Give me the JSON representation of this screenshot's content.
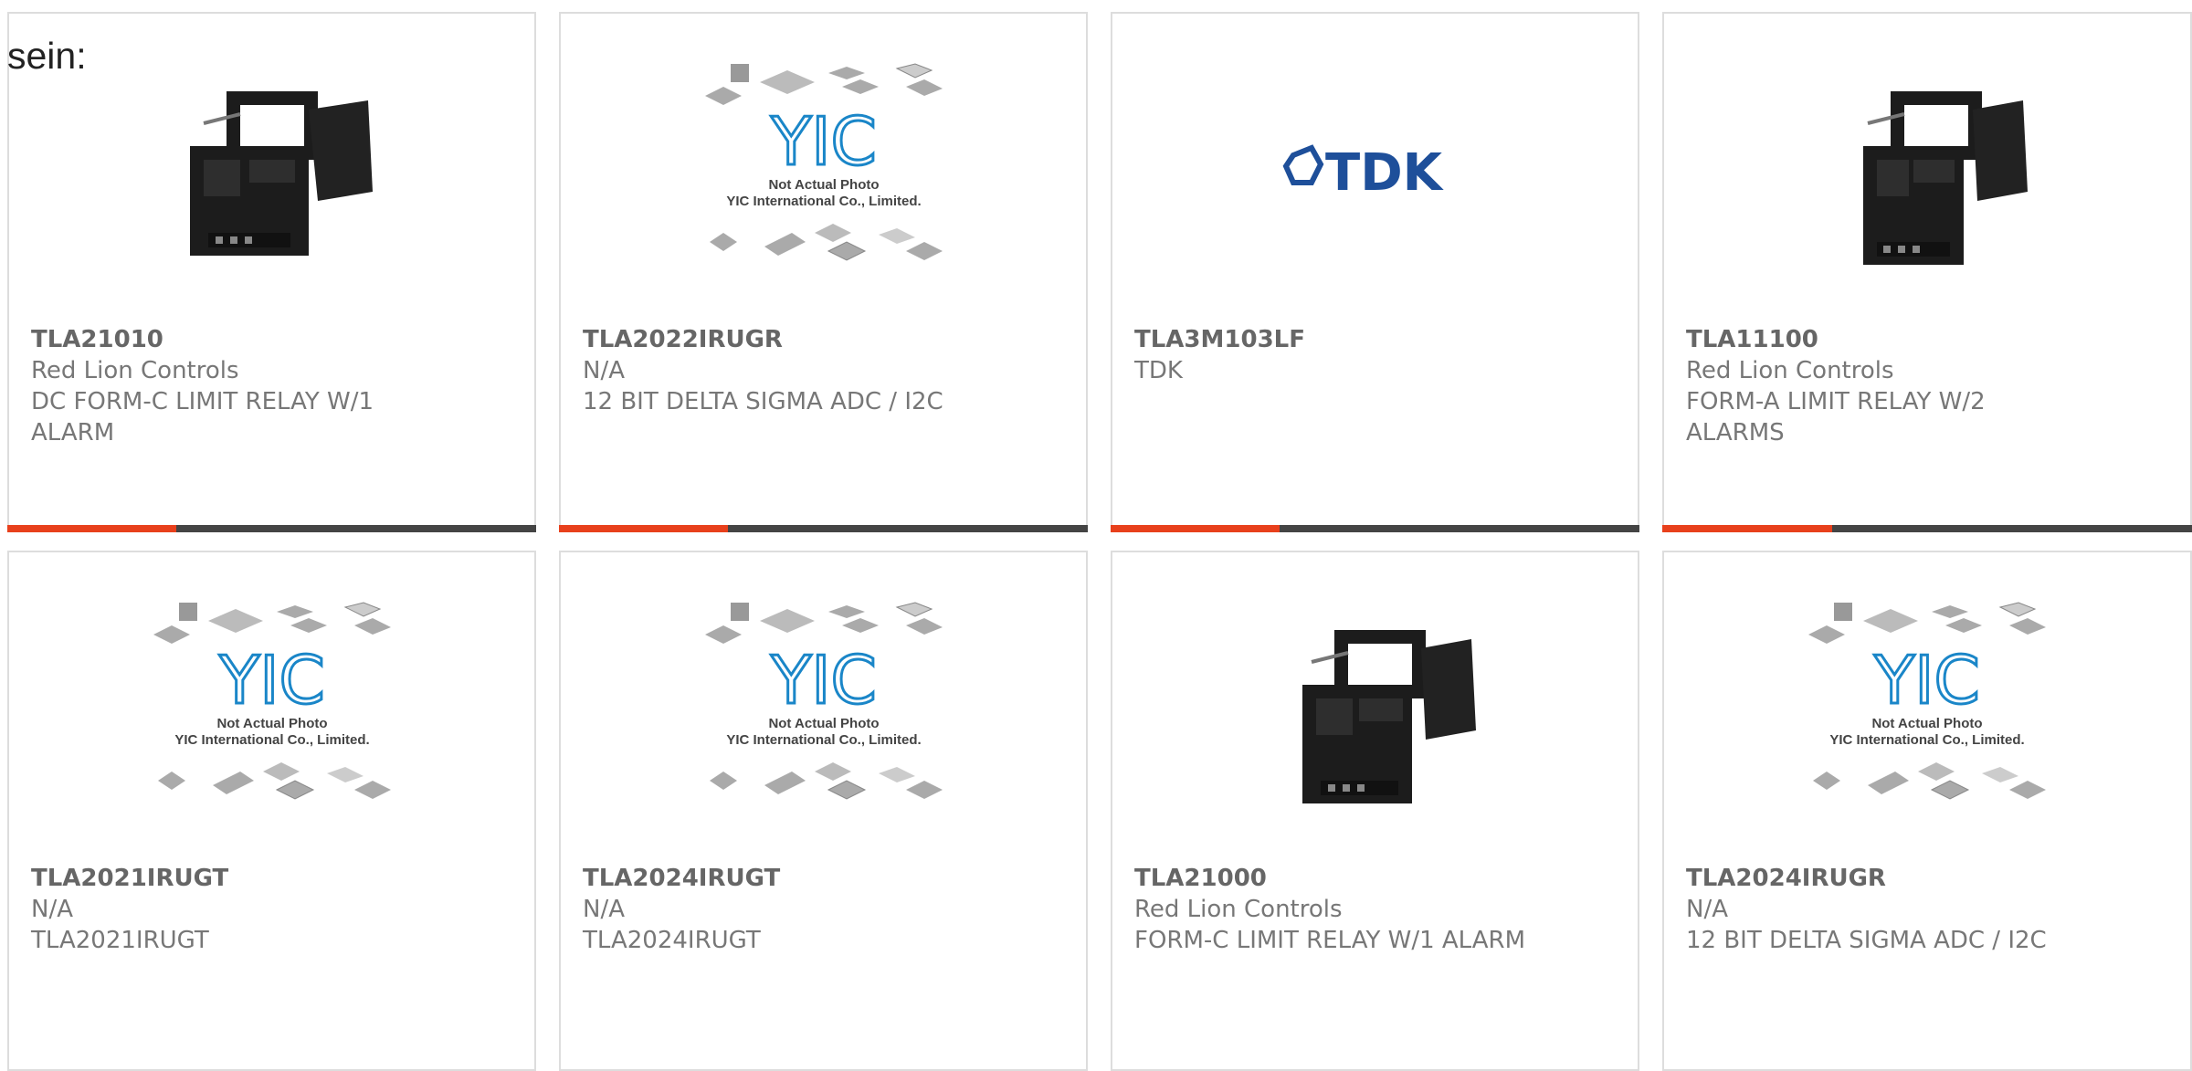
{
  "heading": "sein:",
  "colors": {
    "accent": "#e8401c",
    "bar_dark": "#444444",
    "yic_blue": "#1a86c8",
    "tdk_blue": "#1e4f9a"
  },
  "products": [
    {
      "part": "TLA21010",
      "maker": "Red Lion Controls",
      "desc": "DC FORM-C LIMIT RELAY W/1 ALARM",
      "image": "relay-photo",
      "accent_fraction": 0.32
    },
    {
      "part": "TLA2022IRUGR",
      "maker": "N/A",
      "desc": "12 BIT DELTA SIGMA ADC / I2C",
      "image": "yic-placeholder",
      "accent_fraction": 0.32
    },
    {
      "part": "TLA3M103LF",
      "maker": "TDK",
      "desc": "",
      "image": "tdk-logo",
      "accent_fraction": 0.32
    },
    {
      "part": "TLA11100",
      "maker": "Red Lion Controls",
      "desc": "FORM-A LIMIT RELAY W/2 ALARMS",
      "image": "relay-photo",
      "accent_fraction": 0.32
    },
    {
      "part": "TLA2021IRUGT",
      "maker": "N/A",
      "desc": "TLA2021IRUGT",
      "image": "yic-placeholder"
    },
    {
      "part": "TLA2024IRUGT",
      "maker": "N/A",
      "desc": "TLA2024IRUGT",
      "image": "yic-placeholder"
    },
    {
      "part": "TLA21000",
      "maker": "Red Lion Controls",
      "desc": "FORM-C LIMIT RELAY W/1 ALARM",
      "image": "relay-photo"
    },
    {
      "part": "TLA2024IRUGR",
      "maker": "N/A",
      "desc": "12 BIT DELTA SIGMA ADC / I2C",
      "image": "yic-placeholder"
    }
  ],
  "yic": {
    "caption_line1": "Not Actual Photo",
    "caption_line2": "YIC International Co., Limited.",
    "logo": "YIC"
  },
  "tdk": {
    "logo_text": "TDK"
  }
}
